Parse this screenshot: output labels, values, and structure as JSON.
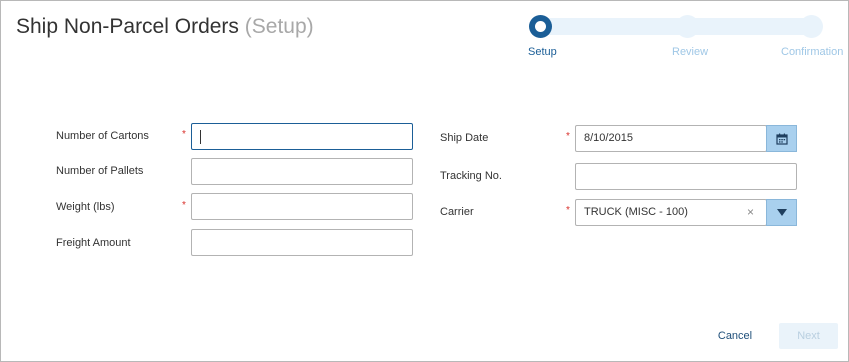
{
  "header": {
    "title": "Ship Non-Parcel Orders",
    "subtitle": "(Setup)"
  },
  "steps": [
    {
      "label": "Setup",
      "state": "active"
    },
    {
      "label": "Review",
      "state": "pending"
    },
    {
      "label": "Confirmation",
      "state": "pending"
    }
  ],
  "form": {
    "required_mark": "*",
    "cartons": {
      "label": "Number of Cartons",
      "value": "",
      "required": true
    },
    "pallets": {
      "label": "Number of Pallets",
      "value": "",
      "required": false
    },
    "weight": {
      "label": "Weight (lbs)",
      "value": "",
      "required": true
    },
    "freight": {
      "label": "Freight Amount",
      "value": "",
      "required": false
    },
    "ship_date": {
      "label": "Ship Date",
      "value": "8/10/2015",
      "required": true
    },
    "tracking": {
      "label": "Tracking No.",
      "value": "",
      "required": false
    },
    "carrier": {
      "label": "Carrier",
      "value": "TRUCK (MISC - 100)",
      "required": true,
      "clear_glyph": "×"
    }
  },
  "footer": {
    "cancel_label": "Cancel",
    "next_label": "Next"
  },
  "colors": {
    "accent": "#1b5e97",
    "required": "#d9302b",
    "addon": "#a9d0ee",
    "step_inactive": "#e9f3fb"
  },
  "icons": {
    "date": "calendar-icon",
    "carrier": "caret-down-icon"
  }
}
